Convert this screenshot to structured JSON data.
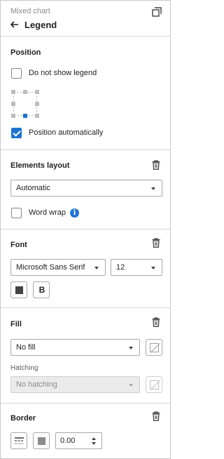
{
  "header": {
    "breadcrumb": "Mixed chart",
    "title": "Legend",
    "back_icon": "arrow-left-icon",
    "undock_icon": "undock-window-icon"
  },
  "position": {
    "title": "Position",
    "hide_legend": {
      "label": "Do not show legend",
      "checked": false
    },
    "grid_selected": "bottom-center",
    "auto_position": {
      "label": "Position automatically",
      "checked": true
    }
  },
  "elements_layout": {
    "title": "Elements layout",
    "layout_value": "Automatic",
    "word_wrap": {
      "label": "Word wrap",
      "checked": false
    },
    "info_icon_glyph": "i"
  },
  "font": {
    "title": "Font",
    "family": "Microsoft Sans Serif",
    "size": "12",
    "bold_label": "B"
  },
  "fill": {
    "title": "Fill",
    "fill_value": "No fill",
    "hatching_label": "Hatching",
    "hatching_value": "No hatching"
  },
  "border": {
    "title": "Border",
    "width_value": "0.00"
  },
  "colors": {
    "accent": "#1e73d2",
    "border": "#a8a8a8",
    "divider": "#d6d6d6"
  }
}
